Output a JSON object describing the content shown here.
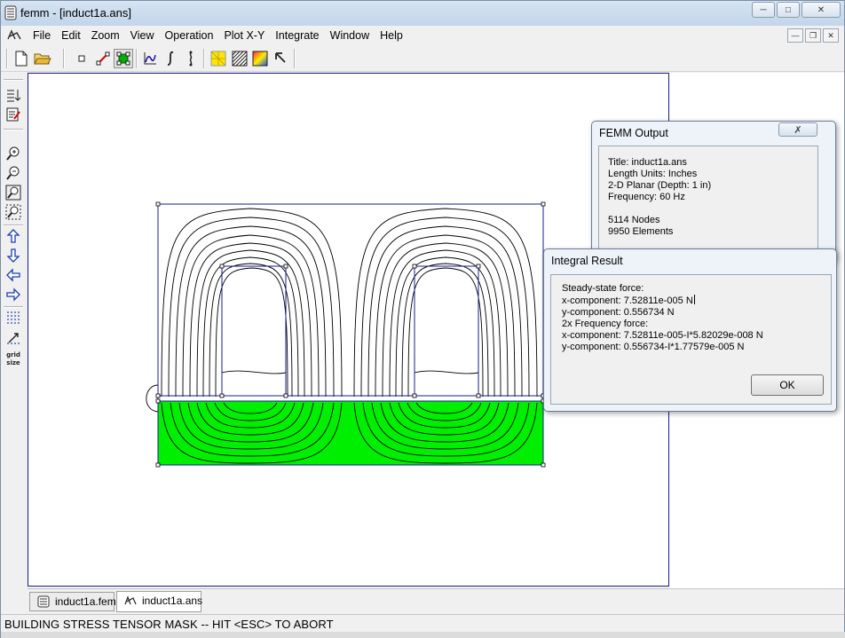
{
  "window": {
    "title": "femm - [induct1a.ans]"
  },
  "menu": {
    "items": [
      "File",
      "Edit",
      "Zoom",
      "View",
      "Operation",
      "Plot X-Y",
      "Integrate",
      "Window",
      "Help"
    ]
  },
  "left_toolbar": {
    "grid_size_label": "grid\nsize"
  },
  "femm_output": {
    "title": "FEMM Output",
    "lines": [
      "Title: induct1a.ans",
      "Length Units: Inches",
      "2-D Planar (Depth: 1 in)",
      "Frequency: 60 Hz",
      "",
      "5114 Nodes",
      "9950 Elements"
    ]
  },
  "integral_result": {
    "title": "Integral Result",
    "lines": [
      "Steady-state force:",
      "x-component: 7.52811e-005 N",
      "y-component: 0.556734 N",
      "2x Frequency force:",
      "x-component: 7.52811e-005-I*5.82029e-008 N",
      "y-component: 0.556734-I*1.77579e-005 N"
    ],
    "ok_label": "OK"
  },
  "doc_tabs": [
    {
      "label": "induct1a.fem",
      "icon": "femm-document-icon",
      "active": false
    },
    {
      "label": "induct1a.ans",
      "icon": "femm-result-icon",
      "active": true
    }
  ],
  "status": {
    "text": "BUILDING STRESS TENSOR MASK -- HIT <ESC> TO ABORT"
  },
  "colors": {
    "selected_region": "#00ee00",
    "outline": "#1b1b8f",
    "contour": "#000000"
  }
}
